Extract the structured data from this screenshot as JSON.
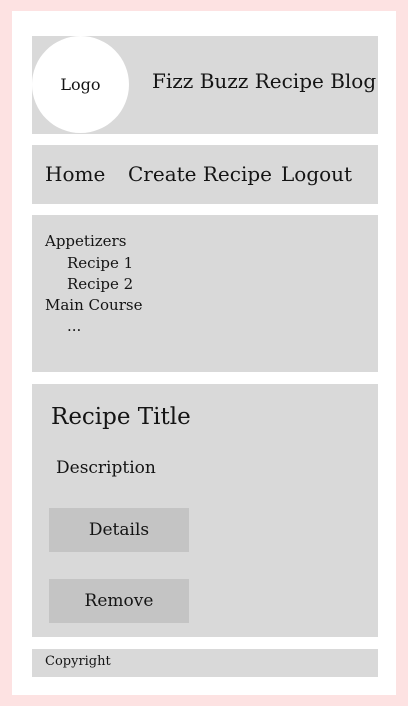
{
  "header": {
    "logo_text": "Logo",
    "blog_title": "Fizz Buzz Recipe Blog"
  },
  "nav": {
    "items": [
      {
        "label": "Home"
      },
      {
        "label": "Create Recipe"
      },
      {
        "label": "Logout"
      }
    ]
  },
  "sidebar": {
    "categories": [
      {
        "label": "Appetizers",
        "recipes": [
          "Recipe 1",
          "Recipe 2"
        ]
      },
      {
        "label": "Main Course",
        "recipes": [
          "..."
        ]
      }
    ]
  },
  "recipe": {
    "title": "Recipe Title",
    "description": "Description",
    "details_label": "Details",
    "remove_label": "Remove"
  },
  "footer": {
    "copyright": "Copyright"
  },
  "colors": {
    "page_background": "#fde2e2",
    "panel": "#d9d9d9",
    "button": "#c4c4c4"
  }
}
